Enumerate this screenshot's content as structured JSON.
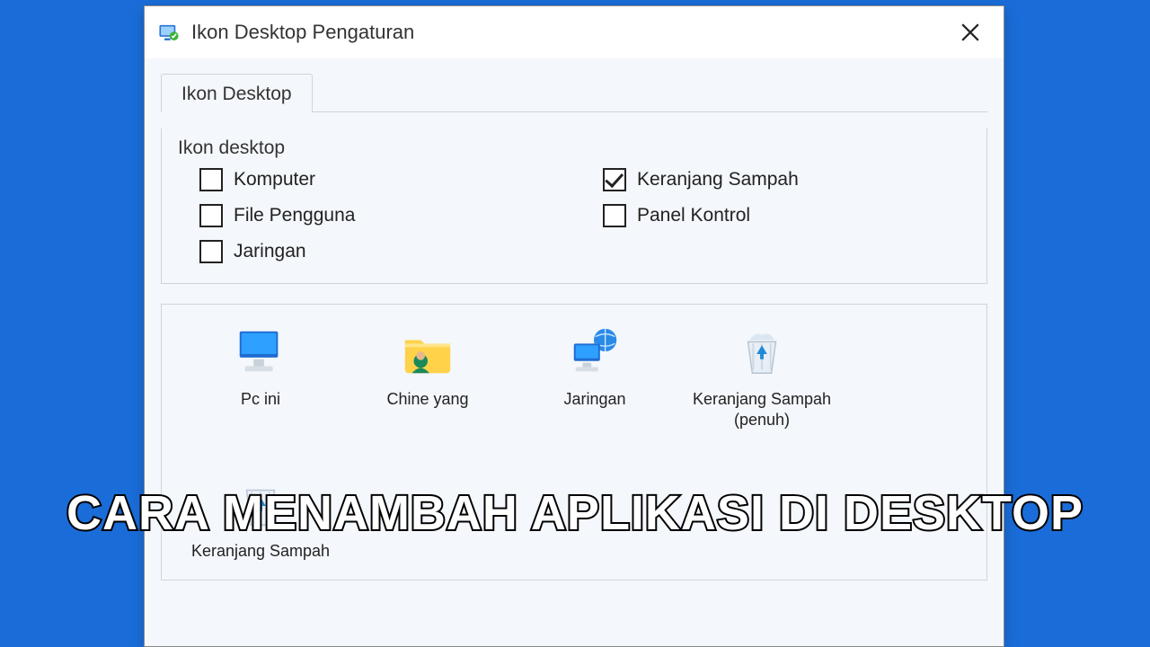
{
  "dialog": {
    "title": "Ikon Desktop Pengaturan",
    "tab": "Ikon Desktop",
    "group_title": "Ikon desktop",
    "checks": [
      {
        "label": "Komputer",
        "checked": false
      },
      {
        "label": "Keranjang Sampah",
        "checked": true
      },
      {
        "label": "File Pengguna",
        "checked": false
      },
      {
        "label": "Panel Kontrol",
        "checked": false
      },
      {
        "label": "Jaringan",
        "checked": false
      }
    ],
    "icons": [
      {
        "label": "Pc ini",
        "icon": "computer"
      },
      {
        "label": "Chine yang",
        "icon": "user-folder"
      },
      {
        "label": "Jaringan",
        "icon": "network"
      },
      {
        "label": "Keranjang Sampah (penuh)",
        "icon": "recycle-full"
      },
      {
        "label": "Keranjang Sampah",
        "icon": "recycle-empty"
      }
    ]
  },
  "caption": "CARA MENAMBAH APLIKASI DI DESKTOP"
}
